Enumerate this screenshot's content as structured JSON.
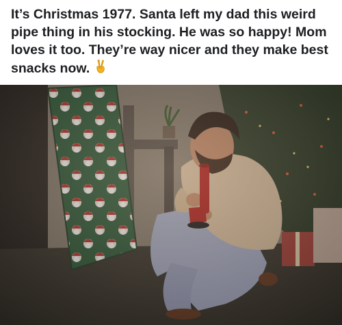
{
  "post": {
    "caption_text": "It’s Christmas 1977. Santa left my dad this weird pipe thing in his stocking. He was so happy! Mom loves it too. They’re way nicer and they make best snacks now.",
    "caption_emoji": "peace-sign-hand-emoji"
  },
  "photo": {
    "subject": "vintage-christmas-photo",
    "colors": {
      "floor": "#3a352d",
      "wall": "#8a7e70",
      "wrapping_green": "#2f5b3a",
      "wrapping_red": "#b8322c",
      "sweater": "#dcc0a0",
      "pants": "#a9aec8",
      "bong_red": "#b51f1c",
      "tree": "#2e3a26"
    }
  }
}
